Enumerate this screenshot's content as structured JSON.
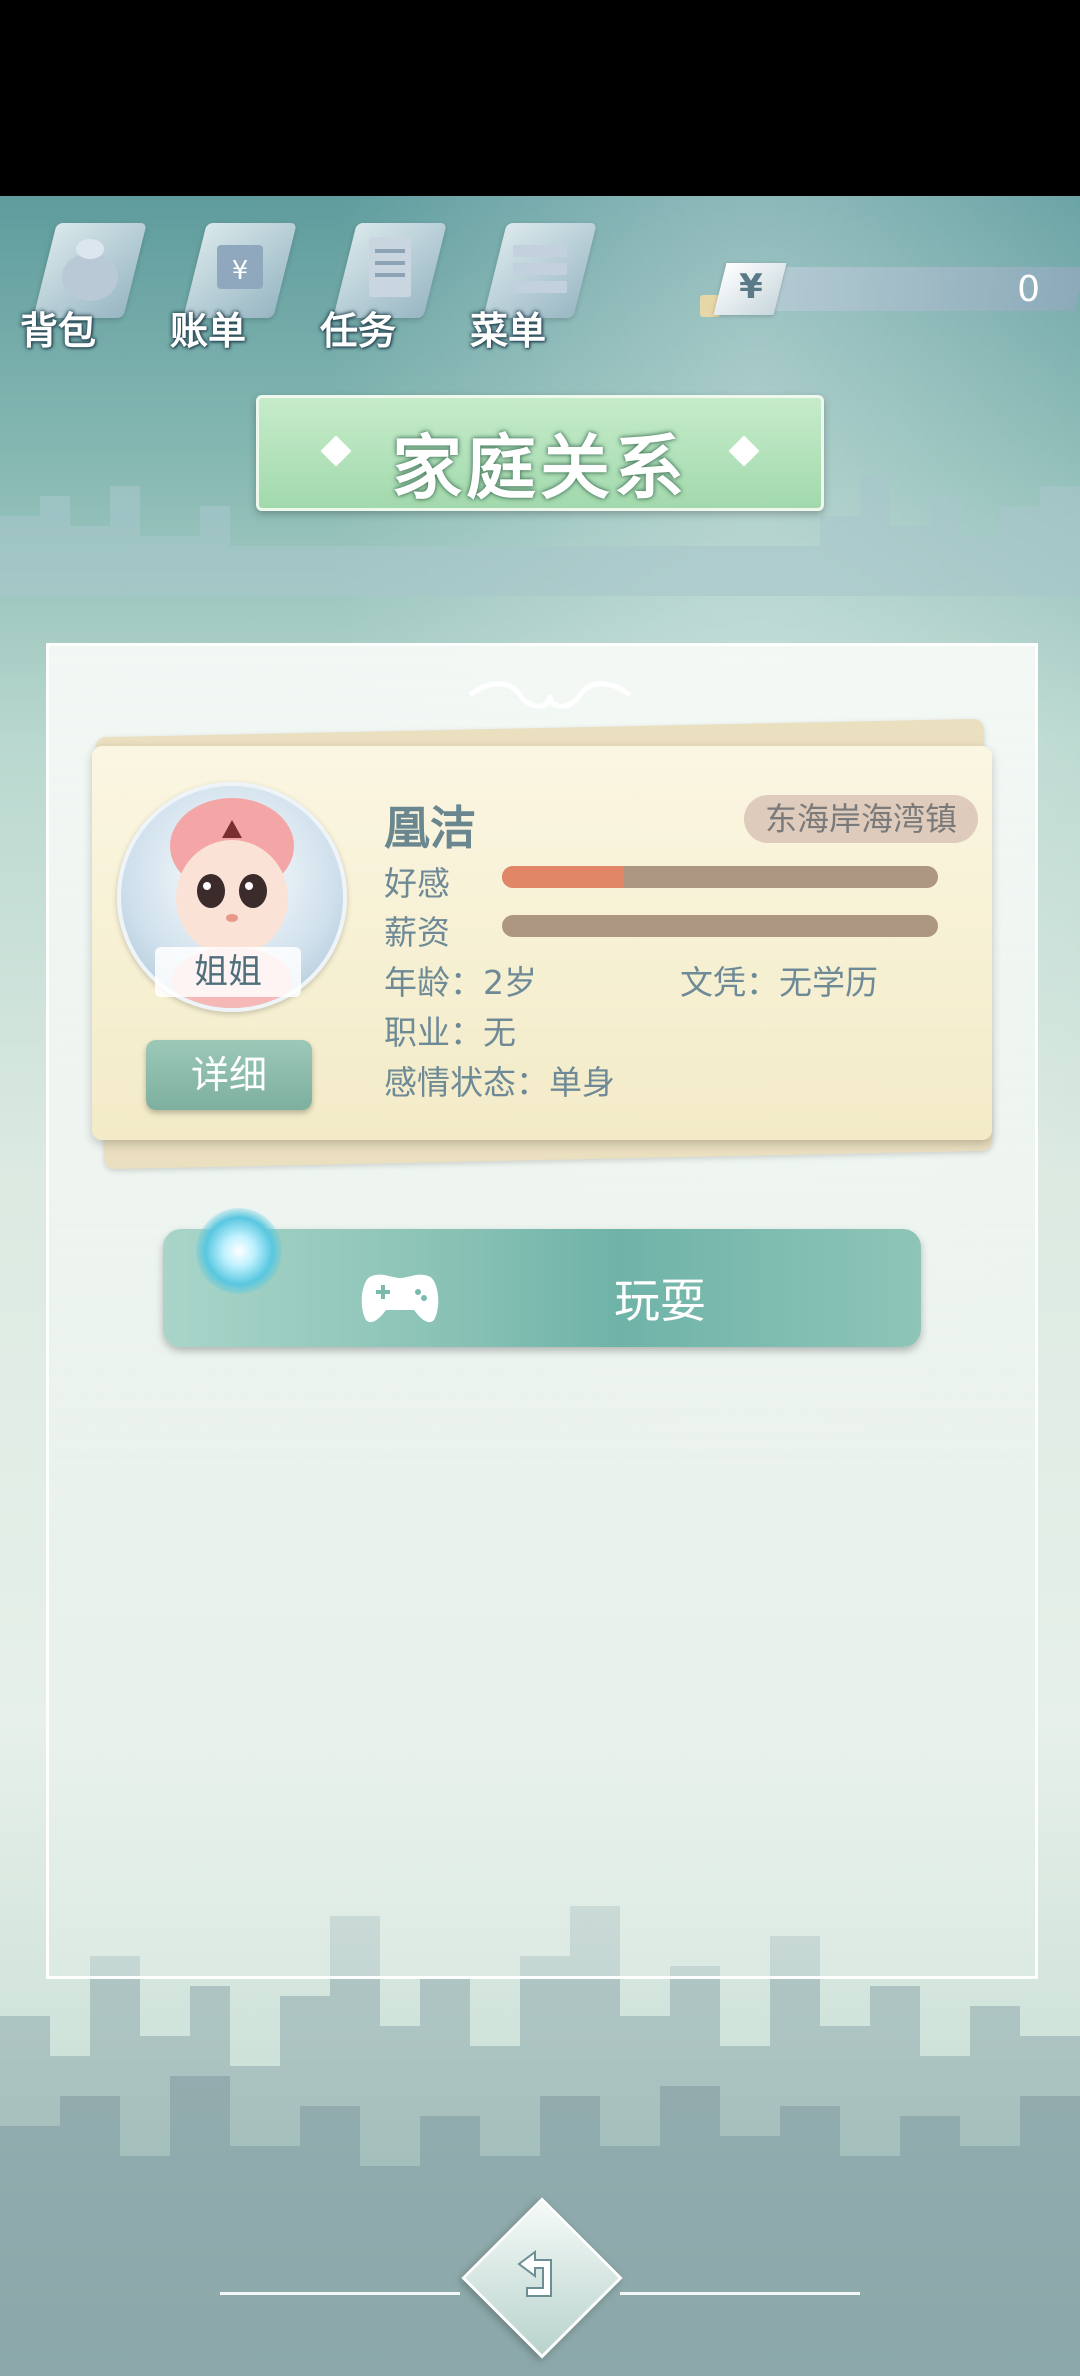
{
  "toolbar": {
    "items": [
      {
        "label": "背包",
        "icon": "bag-icon"
      },
      {
        "label": "账单",
        "icon": "bill-icon"
      },
      {
        "label": "任务",
        "icon": "task-icon"
      },
      {
        "label": "菜单",
        "icon": "menu-icon"
      }
    ]
  },
  "money": {
    "currency_symbol": "¥",
    "amount": "0"
  },
  "page": {
    "title": "家庭关系"
  },
  "member": {
    "relation": "姐姐",
    "name": "凰洁",
    "location": "东海岸海湾镇",
    "detail_label": "详细",
    "stats": {
      "affection_label": "好感",
      "affection_level": 0.28,
      "salary_label": "薪资",
      "salary_level": 0.0
    },
    "age": "年龄：2岁",
    "education": "文凭：无学历",
    "occupation": "职业：无",
    "relationship_status": "感情状态：单身"
  },
  "actions": {
    "play_label": "玩耍"
  },
  "colors": {
    "affection_fill": "#e28668",
    "bar_track": "#ad9682",
    "card_bg": "#fbf6e2",
    "title_banner": "#b4e3bb",
    "play_button": "#7bbaad"
  }
}
